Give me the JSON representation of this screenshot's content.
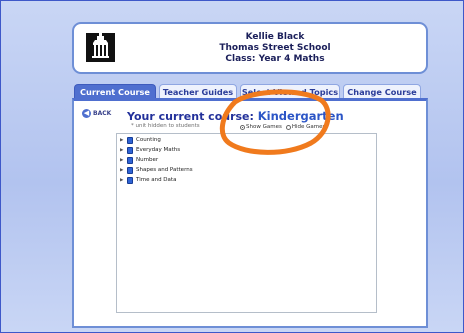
{
  "header": {
    "name": "Kellie Black",
    "school": "Thomas Street School",
    "class_line": "Class: Year 4 Maths"
  },
  "tabs": [
    {
      "label": "Current Course"
    },
    {
      "label": "Teacher Guides"
    },
    {
      "label": "Select Viewed Topics"
    },
    {
      "label": "Change Course"
    }
  ],
  "content": {
    "back_label": "BACK",
    "title_prefix": "Your current course:",
    "course_name": "Kindergarten",
    "hidden_note": "* unit hidden to students",
    "show_games_label": "Show Games",
    "hide_games_label": "Hide Games",
    "topics": [
      "Counting",
      "Everyday Maths",
      "Number",
      "Shapes and Patterns",
      "Time and Data"
    ]
  },
  "colors": {
    "accent": "#4f6fcf",
    "annotation": "#f07a1d"
  }
}
